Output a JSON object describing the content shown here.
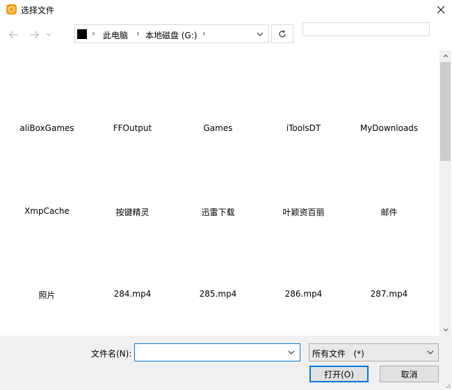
{
  "window": {
    "title": "选择文件"
  },
  "nav": {
    "address_segments": [
      "此电脑",
      "本地磁盘 (G:)"
    ],
    "search_placeholder": ""
  },
  "items": [
    {
      "label": "aliBoxGames"
    },
    {
      "label": "FFOutput"
    },
    {
      "label": "Games"
    },
    {
      "label": "iToolsDT"
    },
    {
      "label": "MyDownloads"
    },
    {
      "label": "XmpCache"
    },
    {
      "label": "按键精灵"
    },
    {
      "label": "迅雷下载"
    },
    {
      "label": "叶颖资百丽"
    },
    {
      "label": "邮件"
    },
    {
      "label": "照片"
    },
    {
      "label": "284.mp4"
    },
    {
      "label": "285.mp4"
    },
    {
      "label": "286.mp4"
    },
    {
      "label": "287.mp4"
    }
  ],
  "footer": {
    "filename_label": "文件名(N):",
    "filename_value": "",
    "filetype_value": "所有文件   (*)",
    "open_label": "打开(O)",
    "cancel_label": "取消"
  },
  "colors": {
    "accent": "#0078d7",
    "app_icon": "#f2a21a"
  }
}
